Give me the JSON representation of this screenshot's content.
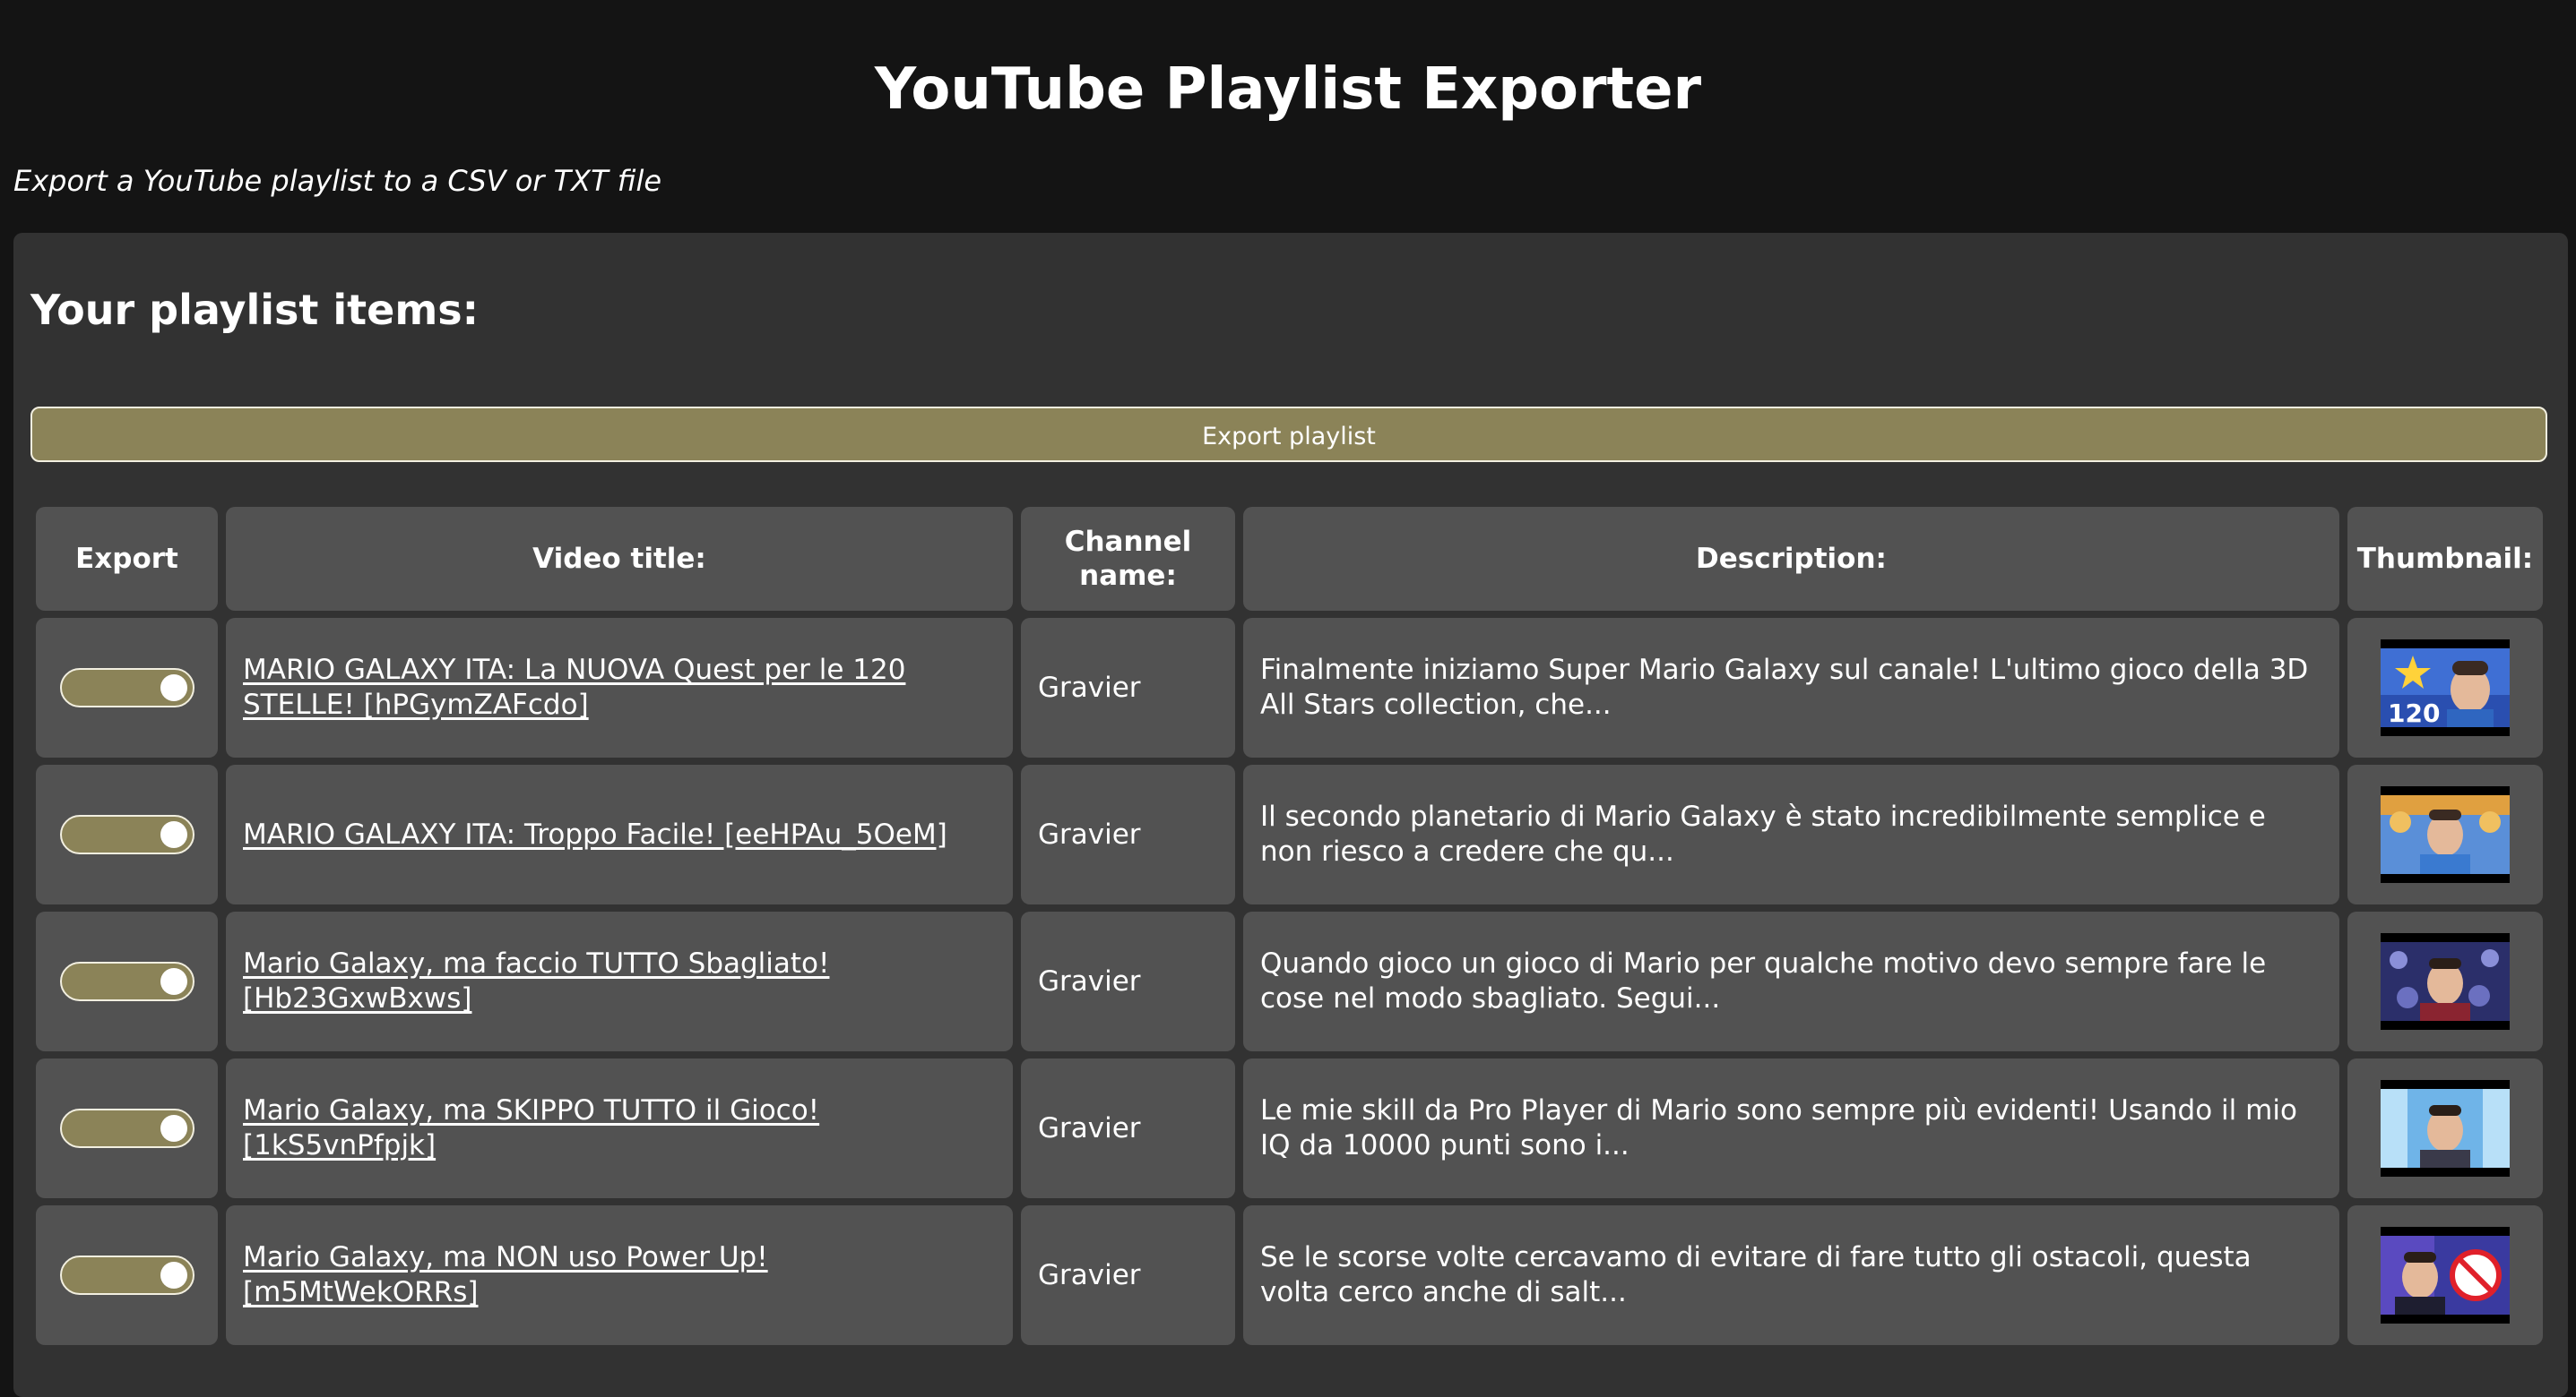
{
  "header": {
    "title": "YouTube Playlist Exporter",
    "subtitle": "Export a YouTube playlist to a CSV or TXT file"
  },
  "panel": {
    "heading": "Your playlist items:",
    "export_button_label": "Export playlist"
  },
  "table": {
    "columns": [
      "Export",
      "Video title:",
      "Channel name:",
      "Description:",
      "Thumbnail:"
    ],
    "rows": [
      {
        "export": true,
        "title": "MARIO GALAXY ITA: La NUOVA Quest per le 120 STELLE! [hPGymZAFcdo]",
        "channel": "Gravier",
        "description": "Finalmente iniziamo Super Mario Galaxy sul canale! L'ultimo gioco della 3D All Stars collection, che...",
        "thumbnail_icon": "video-thumbnail-icon",
        "thumbnail_text": "120"
      },
      {
        "export": true,
        "title": "MARIO GALAXY ITA: Troppo Facile! [eeHPAu_5OeM]",
        "channel": "Gravier",
        "description": "Il secondo planetario di Mario Galaxy è stato incredibilmente semplice e non riesco a credere che qu...",
        "thumbnail_icon": "video-thumbnail-icon",
        "thumbnail_text": ""
      },
      {
        "export": true,
        "title": "Mario Galaxy, ma faccio TUTTO Sbagliato! [Hb23GxwBxws]",
        "channel": "Gravier",
        "description": "Quando gioco un gioco di Mario per qualche motivo devo sempre fare le cose nel modo sbagliato. Segui...",
        "thumbnail_icon": "video-thumbnail-icon",
        "thumbnail_text": ""
      },
      {
        "export": true,
        "title": "Mario Galaxy, ma SKIPPO TUTTO il Gioco! [1kS5vnPfpjk]",
        "channel": "Gravier",
        "description": "Le mie skill da Pro Player di Mario sono sempre più evidenti! Usando il mio IQ da 10000 punti sono i...",
        "thumbnail_icon": "video-thumbnail-icon",
        "thumbnail_text": ""
      },
      {
        "export": true,
        "title": "Mario Galaxy, ma NON uso Power Up! [m5MtWekORRs]",
        "channel": "Gravier",
        "description": "Se le scorse volte cercavamo di evitare di fare tutto gli ostacoli, questa volta cerco anche di salt...",
        "thumbnail_icon": "video-thumbnail-icon",
        "thumbnail_text": ""
      }
    ]
  },
  "colors": {
    "background": "#141414",
    "panel": "#323232",
    "cell": "#525252",
    "accent": "#8b8358"
  }
}
